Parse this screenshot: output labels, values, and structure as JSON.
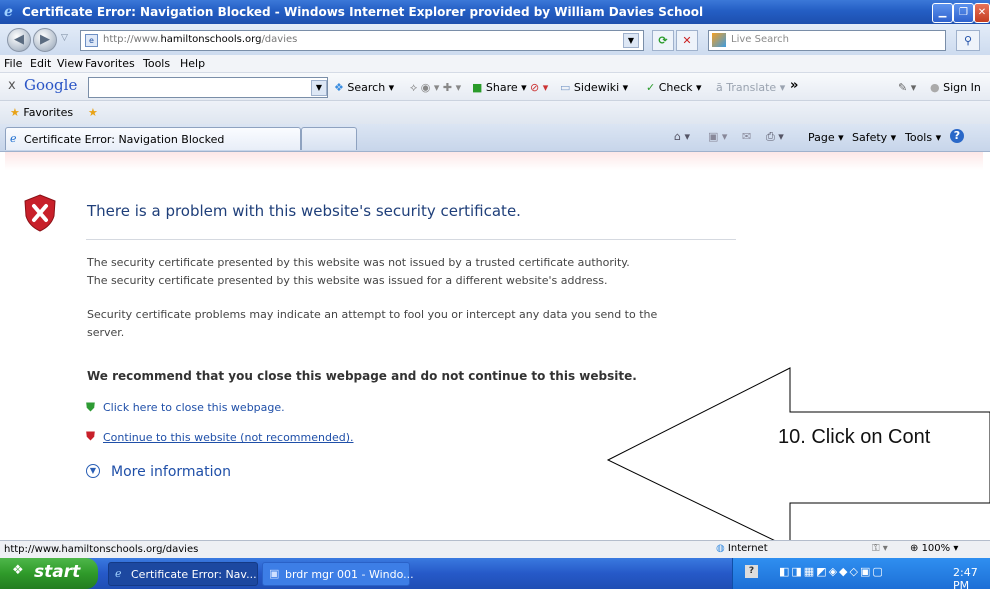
{
  "window": {
    "title": "Certificate Error: Navigation Blocked - Windows Internet Explorer provided by William Davies School"
  },
  "address_bar": {
    "url_prefix": "http://www.",
    "url_domain": "hamiltonschools.org",
    "url_path": "/davies",
    "search_placeholder": "Live Search"
  },
  "menu": [
    "File",
    "Edit",
    "View",
    "Favorites",
    "Tools",
    "Help"
  ],
  "google_toolbar": {
    "close": "x",
    "logo": "Google",
    "search": "Search",
    "share": "Share",
    "sidewiki": "Sidewiki",
    "check": "Check",
    "translate": "Translate",
    "more": "»",
    "sign_in": "Sign In"
  },
  "favorites_bar": {
    "favorites": "Favorites"
  },
  "tab": {
    "label": "Certificate Error: Navigation Blocked"
  },
  "command_bar": {
    "page": "Page",
    "safety": "Safety",
    "tools": "Tools"
  },
  "content": {
    "heading": "There is a problem with this website's security certificate.",
    "line1": "The security certificate presented by this website was not issued by a trusted certificate authority.",
    "line2": "The security certificate presented by this website was issued for a different website's address.",
    "line3a": "Security certificate problems may indicate an attempt to fool you or intercept any data you send to the",
    "line3b": "server.",
    "recommend": "We recommend that you close this webpage and do not continue to this website.",
    "close_link": "Click here to close this webpage.",
    "continue_link": "Continue to this website (not recommended).",
    "more_info": "More information"
  },
  "annotation": {
    "text": "10. Click on Cont"
  },
  "status_bar": {
    "url": "http://www.hamiltonschools.org/davies",
    "zone": "Internet",
    "zoom": "100%"
  },
  "taskbar": {
    "start": "start",
    "tasks": [
      "Certificate Error: Nav...",
      "brdr mgr 001 - Windo..."
    ],
    "clock": "2:47 PM"
  },
  "colors": {
    "title_blue": "#245ec4",
    "link_blue": "#1f4fa8",
    "shield_red": "#c8202a",
    "start_green": "#2f9a2a"
  }
}
